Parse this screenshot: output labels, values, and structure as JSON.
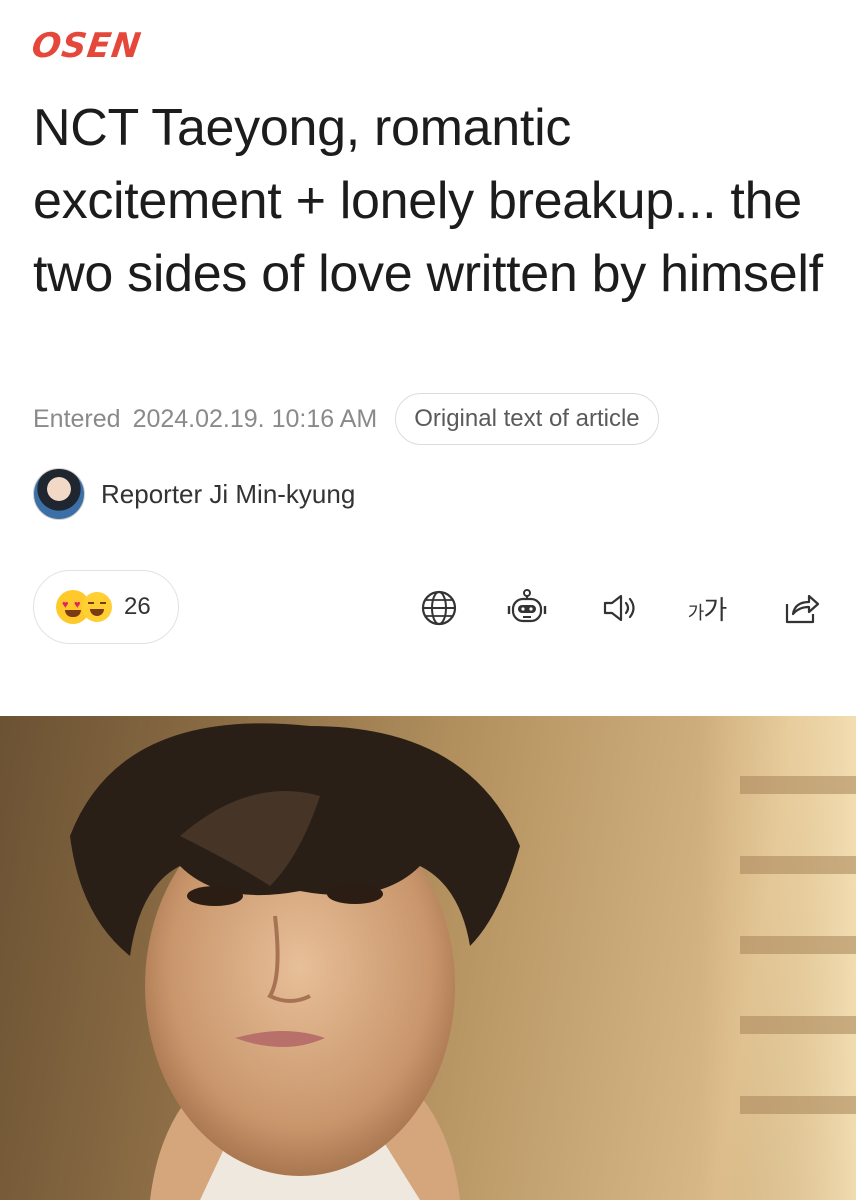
{
  "brand": {
    "logo_text": "OSEN",
    "accent": "#e5483b"
  },
  "article": {
    "headline": "NCT Taeyong, romantic excitement + lonely breakup... the two sides of love written by himself",
    "entered_label": "Entered",
    "entered_datetime": "2024.02.19. 10:16 AM",
    "original_button": "Original text of article",
    "reporter": "Reporter Ji Min-kyung"
  },
  "toolbar": {
    "reaction_count": "26",
    "reaction_icons": [
      "heart-eyes-emoji-icon",
      "grinning-squint-emoji-icon"
    ],
    "tools": [
      "globe-icon",
      "robot-icon",
      "speaker-icon",
      "font-size-icon",
      "share-icon"
    ],
    "font_size_label_small": "가",
    "font_size_label_large": "가"
  },
  "photo": {
    "description_icon": "article-photo"
  }
}
